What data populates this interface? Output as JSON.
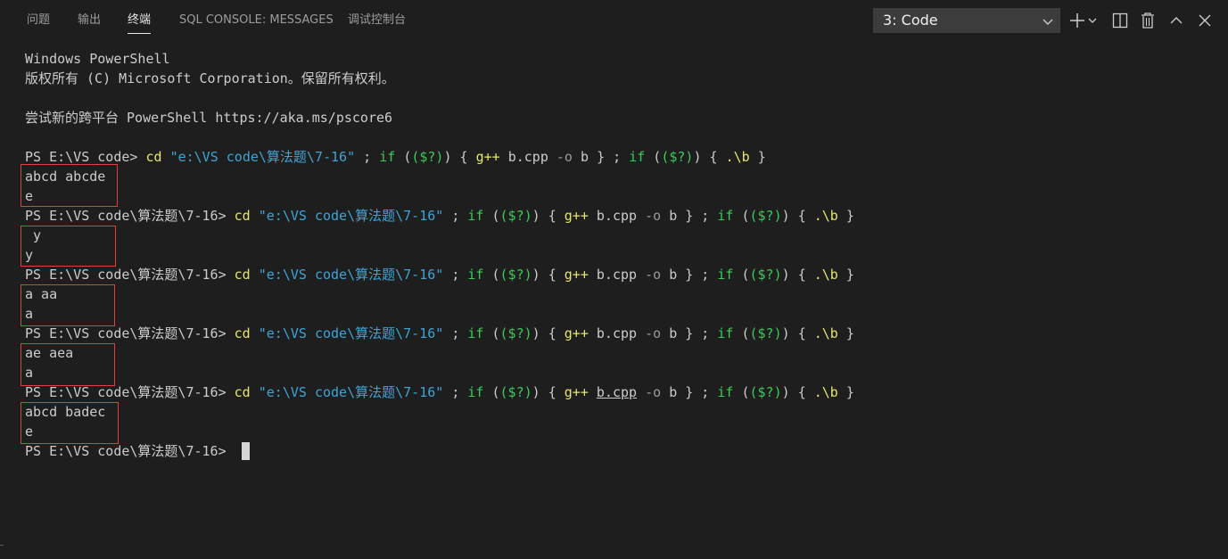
{
  "tabs": [
    {
      "label": "问题",
      "active": false
    },
    {
      "label": "输出",
      "active": false
    },
    {
      "label": "终端",
      "active": true
    },
    {
      "label": "SQL CONSOLE: MESSAGES",
      "active": false
    },
    {
      "label": "调试控制台",
      "active": false
    }
  ],
  "terminal_select": {
    "value": "3: Code"
  },
  "icons": {
    "add": "plus-icon",
    "add_menu": "chevron-down-icon",
    "split": "split-terminal-icon",
    "kill": "trash-icon",
    "maximize": "chevron-up-icon",
    "close": "close-icon"
  },
  "terminal": {
    "header": {
      "line1": "Windows PowerShell",
      "line2": "版权所有 (C) Microsoft Corporation。保留所有权利。",
      "line3": "尝试新的跨平台 PowerShell https://aka.ms/pscore6"
    },
    "first_prompt": "PS E:\\VS code> ",
    "prompt": "PS E:\\VS code\\算法题\\7-16> ",
    "cmd": {
      "cd": "cd",
      "path": "\"e:\\VS code\\算法题\\7-16\"",
      "sep1": " ; ",
      "if": "if",
      "cond": "($?)",
      "open_brace": "{",
      "gpp": "g++",
      "src": "b.cpp",
      "flag": "-o",
      "out": "b",
      "close_brace": "}",
      "run": ".\\b"
    },
    "runs": [
      {
        "input": "abcd abcde",
        "output": "e"
      },
      {
        "input": " y",
        "output": "y"
      },
      {
        "input": "a aa",
        "output": "a"
      },
      {
        "input": "ae aea",
        "output": "a"
      },
      {
        "input": "abcd badec",
        "output": "e"
      }
    ]
  },
  "colors": {
    "background": "#1e1e1e",
    "command": "#e6e66e",
    "string": "#3ea4d6",
    "keyword": "#3dc95a",
    "highlight_box": "#e0413f"
  }
}
